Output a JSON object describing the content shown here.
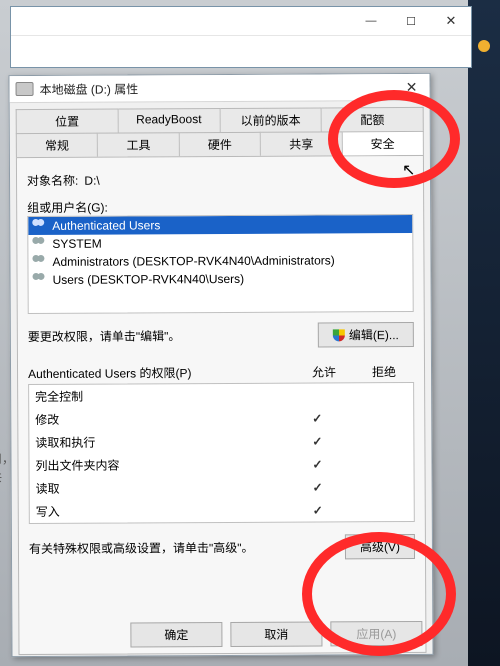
{
  "outer_window": {
    "min": "—",
    "max": "☐",
    "close": "✕"
  },
  "dialog": {
    "title": "本地磁盘 (D:) 属性",
    "close": "✕",
    "tabs_row1": [
      {
        "label": "位置"
      },
      {
        "label": "ReadyBoost"
      },
      {
        "label": "以前的版本"
      },
      {
        "label": "配额"
      }
    ],
    "tabs_row2": [
      {
        "label": "常规"
      },
      {
        "label": "工具"
      },
      {
        "label": "硬件"
      },
      {
        "label": "共享"
      },
      {
        "label": "安全",
        "active": true
      }
    ],
    "object_name_label": "对象名称:",
    "object_name_value": "D:\\",
    "group_label": "组或用户名(G):",
    "principals": [
      "Authenticated Users",
      "SYSTEM",
      "Administrators (DESKTOP-RVK4N40\\Administrators)",
      "Users (DESKTOP-RVK4N40\\Users)"
    ],
    "edit_hint": "要更改权限，请单击\"编辑\"。",
    "edit_button": "编辑(E)...",
    "perm_header_name": "Authenticated Users 的权限(P)",
    "perm_header_allow": "允许",
    "perm_header_deny": "拒绝",
    "permissions": [
      {
        "name": "完全控制",
        "allow": false,
        "deny": false
      },
      {
        "name": "修改",
        "allow": true,
        "deny": false
      },
      {
        "name": "读取和执行",
        "allow": true,
        "deny": false
      },
      {
        "name": "列出文件夹内容",
        "allow": true,
        "deny": false
      },
      {
        "name": "读取",
        "allow": true,
        "deny": false
      },
      {
        "name": "写入",
        "allow": true,
        "deny": false
      }
    ],
    "advanced_hint": "有关特殊权限或高级设置，请单击\"高级\"。",
    "advanced_button": "高级(V)",
    "ok": "确定",
    "cancel": "取消",
    "apply": "应用(A)"
  },
  "bg_text": {
    "line1": "用，",
    "line2": "共"
  }
}
